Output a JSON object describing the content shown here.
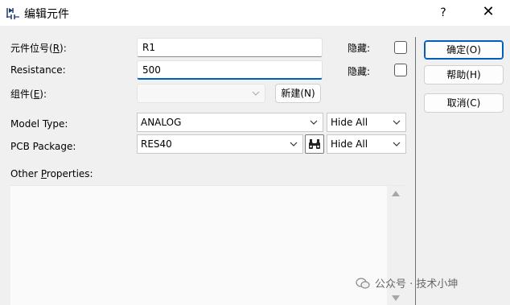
{
  "window": {
    "title": "编辑元件",
    "help_label": "?",
    "close_label": "✕"
  },
  "form": {
    "designator_label": "元件位号(",
    "designator_key": "R",
    "designator_label_end": "):",
    "designator_value": "R1",
    "hide_label_1": "隐藏:",
    "resistance_label": "Resistance:",
    "resistance_value": "500",
    "hide_label_2": "隐藏:",
    "component_label": "组件(",
    "component_key": "E",
    "component_label_end": "):",
    "component_value": "",
    "new_button": "新建(N)",
    "model_type_label": "Model Type:",
    "model_type_value": "ANALOG",
    "model_type_visibility": "Hide All",
    "pcb_package_label": "PCB Package:",
    "pcb_package_value": "RES40",
    "pcb_package_visibility": "Hide All",
    "other_props_label_pre": "Other ",
    "other_props_key": "P",
    "other_props_label_post": "roperties:",
    "other_props_value": ""
  },
  "buttons": {
    "ok": "确定(O)",
    "help": "帮助(H)",
    "cancel": "取消(C)"
  },
  "watermark": {
    "text": "公众号 · 技术小坤"
  },
  "colors": {
    "accent": "#005fb8",
    "background": "#f0f0f0",
    "field_bg": "#ffffff"
  }
}
